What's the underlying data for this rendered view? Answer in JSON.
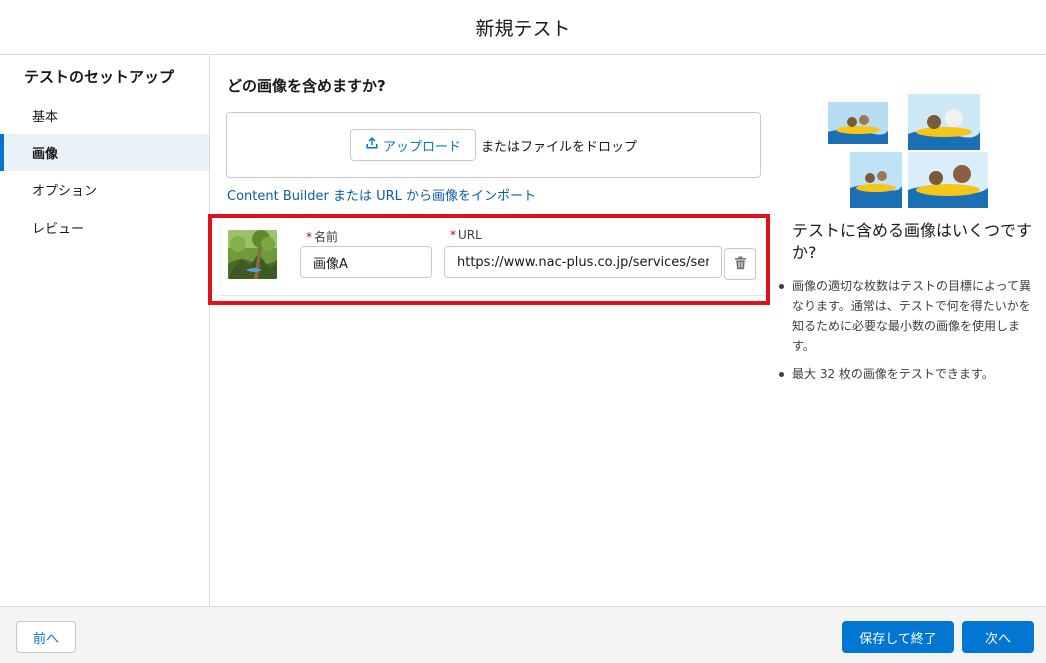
{
  "header": {
    "title": "新規テスト"
  },
  "sidebar": {
    "heading": "テストのセットアップ",
    "items": [
      {
        "label": "基本",
        "active": false
      },
      {
        "label": "画像",
        "active": true
      },
      {
        "label": "オプション",
        "active": false
      },
      {
        "label": "レビュー",
        "active": false
      }
    ]
  },
  "main": {
    "section_title": "どの画像を含めますか?",
    "upload_button": "アップロード",
    "drop_text": "またはファイルをドロップ",
    "import_link": "Content Builder または URL から画像をインポート",
    "image_row": {
      "name_label": "名前",
      "name_value": "画像A",
      "url_label": "URL",
      "url_value": "https://www.nac-plus.co.jp/services/service"
    }
  },
  "help": {
    "title": "テストに含める画像はいくつですか?",
    "bullets": [
      "画像の適切な枚数はテストの目標によって異なります。通常は、テストで何を得たいかを知るために必要な最小数の画像を使用します。",
      "最大 32 枚の画像をテストできます。"
    ]
  },
  "footer": {
    "back_button": "前へ",
    "save_exit_button": "保存して終了",
    "next_button": "次へ"
  },
  "colors": {
    "brand": "#0176d3",
    "highlight": "#e0101c",
    "active_nav_bg": "#e9f1f9"
  },
  "icons": [
    "upload-icon",
    "trash-icon"
  ]
}
